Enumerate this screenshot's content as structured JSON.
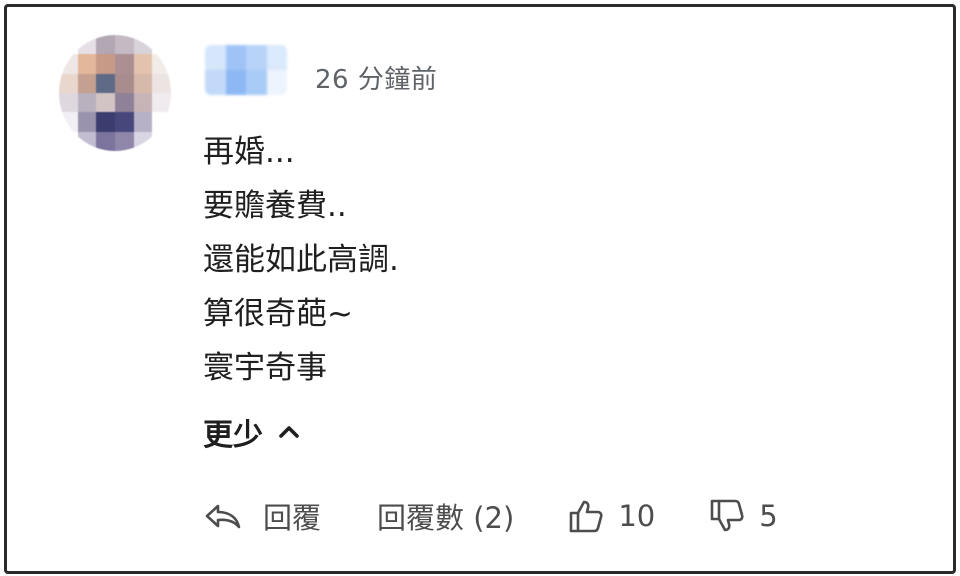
{
  "comment": {
    "timestamp": "26 分鐘前",
    "lines": [
      "再婚...",
      "要贍養費..",
      "還能如此高調.",
      "算很奇葩~",
      "寰宇奇事"
    ],
    "collapse_label": "更少"
  },
  "actions": {
    "reply_label": "回覆",
    "replies_label": "回覆數 (2)",
    "like_count": "10",
    "dislike_count": "5"
  },
  "icons": {
    "reply": "reply-arrow-icon",
    "collapse": "chevron-up-icon",
    "like": "thumbs-up-icon",
    "dislike": "thumbs-down-icon"
  },
  "colors": {
    "text": "#1f1f1f",
    "muted": "#5f6368",
    "border": "#2b2b2b"
  }
}
